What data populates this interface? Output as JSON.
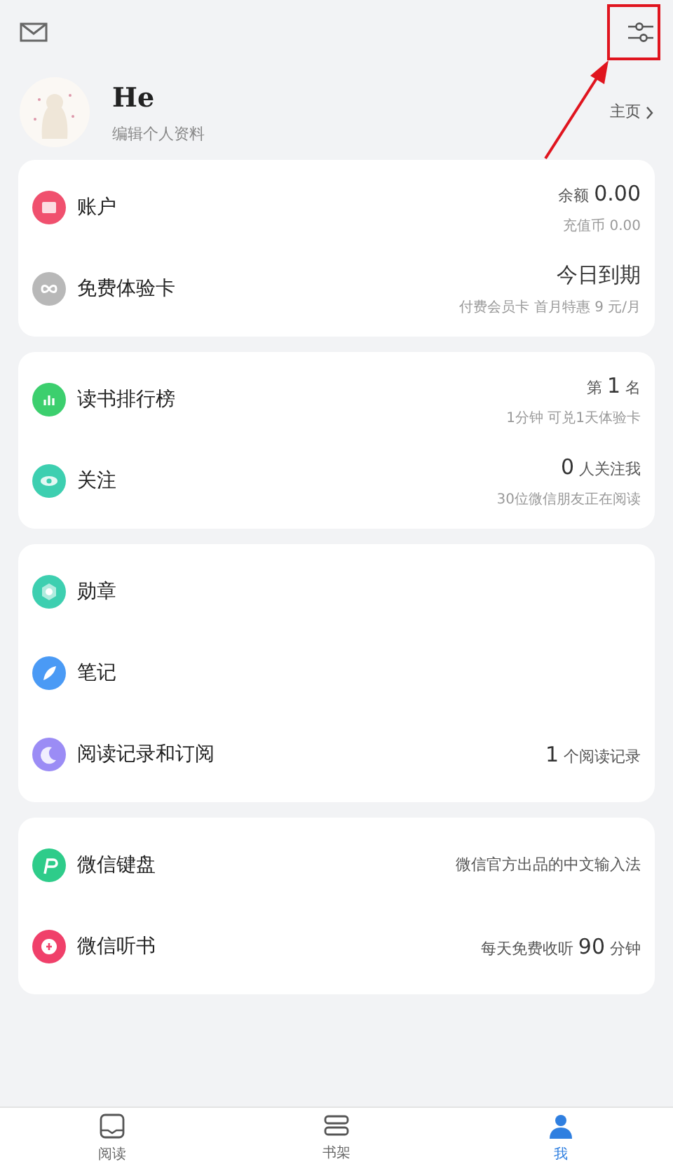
{
  "profile": {
    "name": "He",
    "subtitle": "编辑个人资料",
    "home_link": "主页"
  },
  "groups": [
    [
      {
        "kind": "wallet",
        "color": "#f0506e",
        "label": "账户",
        "prefix": "余额",
        "value": "0.00",
        "sub": "充值币 0.00"
      },
      {
        "kind": "infinity",
        "color": "#b8b8b8",
        "label": "免费体验卡",
        "value": "今日到期",
        "sub": "付费会员卡 首月特惠 9 元/月"
      }
    ],
    [
      {
        "kind": "chart",
        "color": "#3ccf6e",
        "label": "读书排行榜",
        "prefix": "第",
        "value": "1",
        "suffix": "名",
        "sub": "1分钟 可兑1天体验卡"
      },
      {
        "kind": "eye",
        "color": "#3dcfb0",
        "label": "关注",
        "value": "0",
        "suffix": "人关注我",
        "sub": "30位微信朋友正在阅读"
      }
    ],
    [
      {
        "kind": "badge",
        "color": "#3dcfb0",
        "label": "勋章"
      },
      {
        "kind": "feather",
        "color": "#4a9af5",
        "label": "笔记"
      },
      {
        "kind": "moon",
        "color": "#9b8cf5",
        "label": "阅读记录和订阅",
        "value": "1",
        "suffix": "个阅读记录"
      }
    ],
    [
      {
        "kind": "plus",
        "color": "#2ecc8a",
        "label": "微信键盘",
        "suffix": "微信官方出品的中文输入法"
      },
      {
        "kind": "circle",
        "color": "#f0406a",
        "label": "微信听书",
        "prefix": "每天免费收听",
        "value": "90",
        "suffix": "分钟"
      }
    ]
  ],
  "tabs": [
    {
      "kind": "reader",
      "label": "阅读",
      "selected": false
    },
    {
      "kind": "shelf",
      "label": "书架",
      "selected": false
    },
    {
      "kind": "person",
      "label": "我",
      "selected": true
    }
  ]
}
